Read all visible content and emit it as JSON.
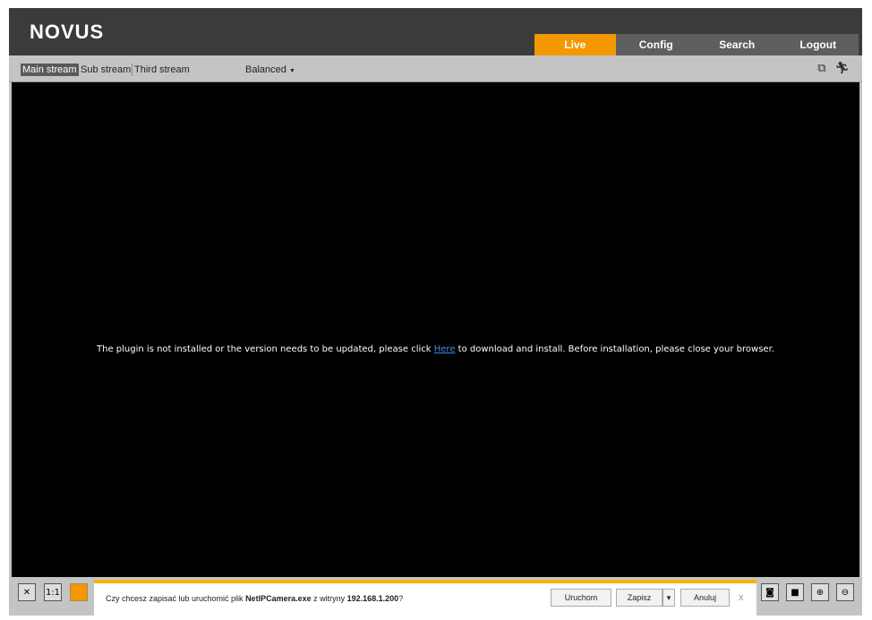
{
  "header": {
    "logo": "NOVUS",
    "tabs": [
      {
        "label": "Live",
        "active": true
      },
      {
        "label": "Config"
      },
      {
        "label": "Search"
      },
      {
        "label": "Logout"
      }
    ]
  },
  "toolbar": {
    "streams": [
      "Main stream",
      "Sub stream",
      "Third stream"
    ],
    "active_stream": "Main stream",
    "quality": "Balanced"
  },
  "video": {
    "msg_before": "The plugin is not installed or the version needs to be updated, please click ",
    "link": "Here",
    "msg_after": " to download and install. Before installation, please close your browser."
  },
  "download_bar": {
    "text_before": "Czy chcesz zapisać lub uruchomić plik ",
    "file": "NetIPCamera.exe",
    "text_mid": " z witryny ",
    "site": "192.168.1.200",
    "text_after": "?",
    "run": "Uruchom",
    "save": "Zapisz",
    "cancel": "Anuluj",
    "close": "x"
  },
  "colors": {
    "accent": "#f39800",
    "header": "#3b3b3b",
    "toolbar": "#c4c4c4"
  }
}
